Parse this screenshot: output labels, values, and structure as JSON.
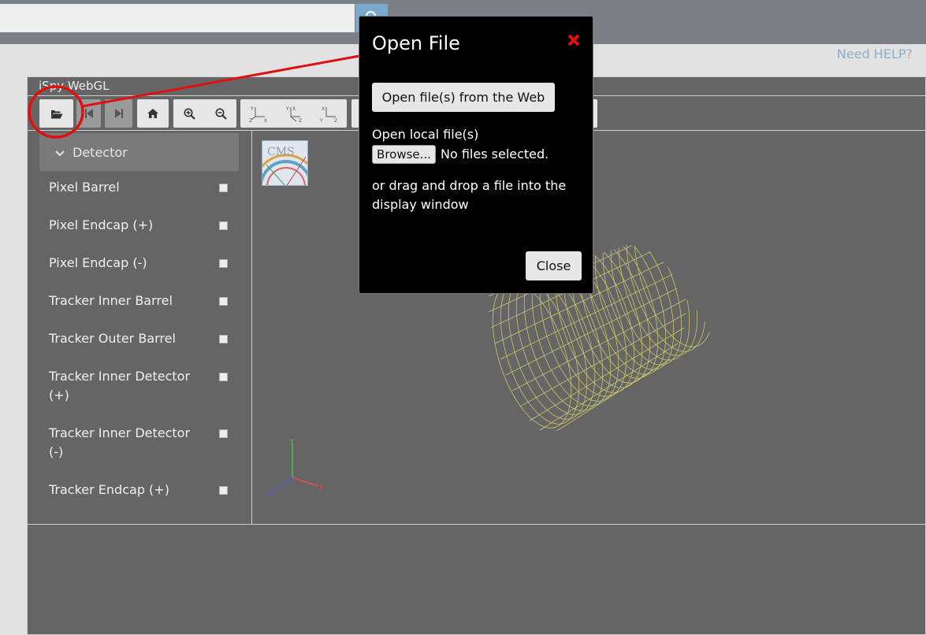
{
  "search": {
    "value": "",
    "placeholder": ""
  },
  "header": {
    "help_link": "Need HELP?"
  },
  "app": {
    "title": "iSpy WebGL"
  },
  "toolbar": {
    "buttons": [
      {
        "name": "open-file",
        "icon": "folder-open-icon"
      },
      {
        "name": "previous-event",
        "icon": "step-backward-icon"
      },
      {
        "name": "next-event",
        "icon": "step-forward-icon"
      },
      {
        "name": "home-view",
        "icon": "home-icon"
      },
      {
        "name": "zoom-in",
        "icon": "zoom-in-icon"
      },
      {
        "name": "zoom-out",
        "icon": "zoom-out-icon"
      },
      {
        "name": "view-xy",
        "icon": "axes-xy-icon"
      },
      {
        "name": "view-yz",
        "icon": "axes-yz-icon"
      },
      {
        "name": "view-xz",
        "icon": "axes-xz-icon"
      }
    ]
  },
  "sidebar": {
    "section": "Detector",
    "items": [
      {
        "label": "Pixel Barrel",
        "checked": false
      },
      {
        "label": "Pixel Endcap (+)",
        "checked": false
      },
      {
        "label": "Pixel Endcap (-)",
        "checked": false
      },
      {
        "label": "Tracker Inner Barrel",
        "checked": false
      },
      {
        "label": "Tracker Outer Barrel",
        "checked": false
      },
      {
        "label": "Tracker Inner Detector (+)",
        "checked": false
      },
      {
        "label": "Tracker Inner Detector (-)",
        "checked": false
      },
      {
        "label": "Tracker Endcap (+)",
        "checked": false
      }
    ]
  },
  "viewport": {
    "axes": {
      "x": "x",
      "y": "y",
      "z": "z"
    },
    "logo_text": "CMS",
    "colors": {
      "detector": "#d6d06a",
      "x_axis": "#e05050",
      "y_axis": "#4fc04f",
      "z_axis": "#5060d0"
    }
  },
  "modal": {
    "title": "Open File",
    "web_button": "Open file(s) from the Web",
    "local_label": "Open local file(s)",
    "browse_button": "Browse...",
    "no_files": "No files selected.",
    "drag_text": "or drag and drop a file into the display window",
    "close_button": "Close"
  },
  "annotation": {
    "color": "#e01010"
  }
}
